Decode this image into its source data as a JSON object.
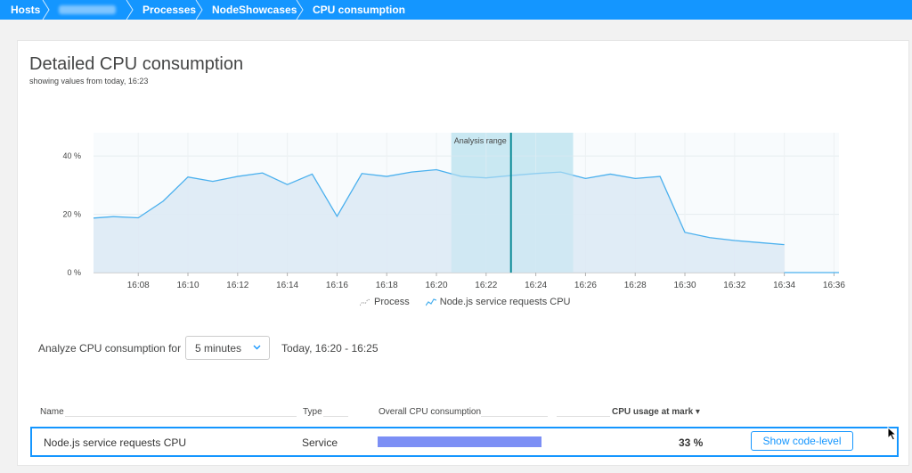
{
  "breadcrumb": {
    "items": [
      {
        "label": "Hosts"
      },
      {
        "label": ""
      },
      {
        "label": "Processes"
      },
      {
        "label": "NodeShowcases"
      },
      {
        "label": "CPU consumption"
      }
    ]
  },
  "page": {
    "title": "Detailed CPU consumption",
    "subtitle": "showing values from today, 16:23"
  },
  "chart_data": {
    "type": "area",
    "y_ticks": [
      "0 %",
      "20 %",
      "40 %"
    ],
    "ylim": [
      0,
      48
    ],
    "x_ticks": [
      "16:08",
      "16:10",
      "16:12",
      "16:14",
      "16:16",
      "16:18",
      "16:20",
      "16:22",
      "16:24",
      "16:26",
      "16:28",
      "16:30",
      "16:32",
      "16:34",
      "16:36"
    ],
    "x_minutes": [
      8,
      10,
      12,
      14,
      16,
      18,
      20,
      22,
      24,
      26,
      28,
      30,
      32,
      34,
      36
    ],
    "xlim": [
      6.2,
      36.2
    ],
    "series": [
      {
        "name": "Node.js service requests CPU",
        "x": [
          6.2,
          7.0,
          8.0,
          9.0,
          10.0,
          11.0,
          12.0,
          13.0,
          14.0,
          15.0,
          16.0,
          17.0,
          18.0,
          19.0,
          20.0,
          21.0,
          22.0,
          23.0,
          24.0,
          25.0,
          26.0,
          27.0,
          28.0,
          29.0,
          30.0,
          31.0,
          32.0,
          33.0,
          34.0
        ],
        "values": [
          18.7,
          19.2,
          18.8,
          24.5,
          32.8,
          31.3,
          33.0,
          34.2,
          30.2,
          33.8,
          19.3,
          34.0,
          33.0,
          34.5,
          35.3,
          33.0,
          32.5,
          33.3,
          34.0,
          34.5,
          32.3,
          33.8,
          32.3,
          33.0,
          13.8,
          12.0,
          11.0,
          10.3,
          9.6
        ]
      }
    ],
    "legend": [
      "Process",
      "Node.js service requests CPU"
    ],
    "analysis_range": {
      "label": "Analysis range",
      "start": 20.6,
      "end": 25.5,
      "mark": 23.0
    },
    "grid": true
  },
  "analyze": {
    "label": "Analyze CPU consumption for",
    "selected": "5 minutes",
    "range": "Today, 16:20 - 16:25"
  },
  "table": {
    "headers": {
      "name": "Name",
      "type": "Type",
      "overall": "Overall CPU consumption",
      "usage": "CPU usage at mark ▾"
    },
    "rows": [
      {
        "name": "Node.js service requests CPU",
        "type": "Service",
        "overall_fraction": 1.0,
        "usage": "33 %",
        "action": "Show code-level"
      }
    ]
  },
  "colors": {
    "accent": "#1496ff",
    "series_line": "#4ab0ee",
    "series_fill": "#dce9f5",
    "range_band": "#c9e8f2",
    "mark_line": "#0a8a96",
    "bar": "#7c8ff5"
  }
}
